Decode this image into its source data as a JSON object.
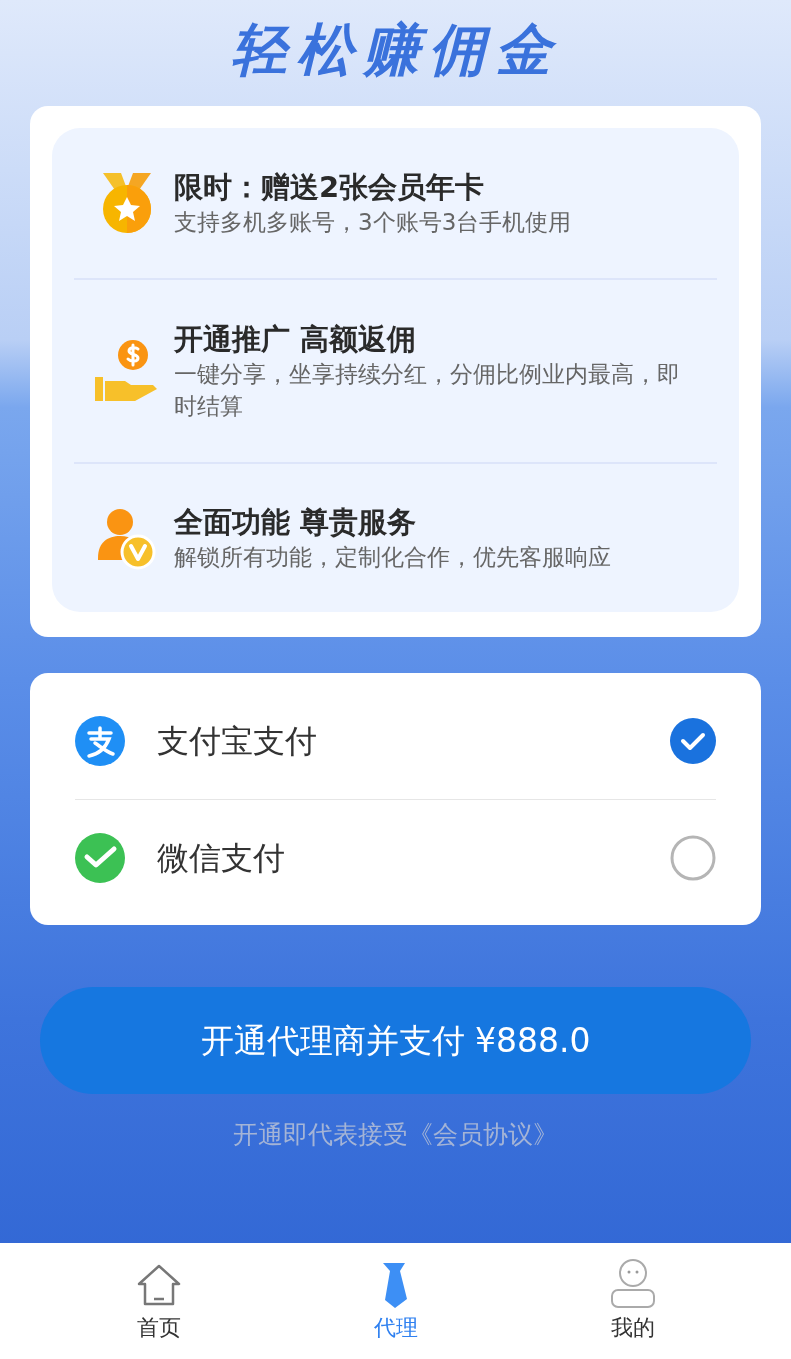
{
  "banner": {
    "title": "轻松赚佣金"
  },
  "benefits": [
    {
      "kind": "medal",
      "title": "限时：赠送2张会员年卡",
      "desc": "支持多机多账号，3个账号3台手机使用"
    },
    {
      "kind": "coin-hand",
      "title": "开通推广 高额返佣",
      "desc": "一键分享，坐享持续分红，分佣比例业内最高，即时结算"
    },
    {
      "kind": "vip-user",
      "title": "全面功能 尊贵服务",
      "desc": "解锁所有功能，定制化合作，优先客服响应"
    }
  ],
  "payment_methods": [
    {
      "kind": "alipay",
      "label": "支付宝支付",
      "selected": true
    },
    {
      "kind": "wechat",
      "label": "微信支付",
      "selected": false
    }
  ],
  "pay_button": "开通代理商并支付 ¥888.0",
  "agreement": "开通即代表接受《会员协议》",
  "tab_bar": [
    {
      "kind": "home",
      "label": "首页",
      "selected": false
    },
    {
      "kind": "agent",
      "label": "代理",
      "selected": true
    },
    {
      "kind": "me",
      "label": "我的",
      "selected": false
    }
  ]
}
